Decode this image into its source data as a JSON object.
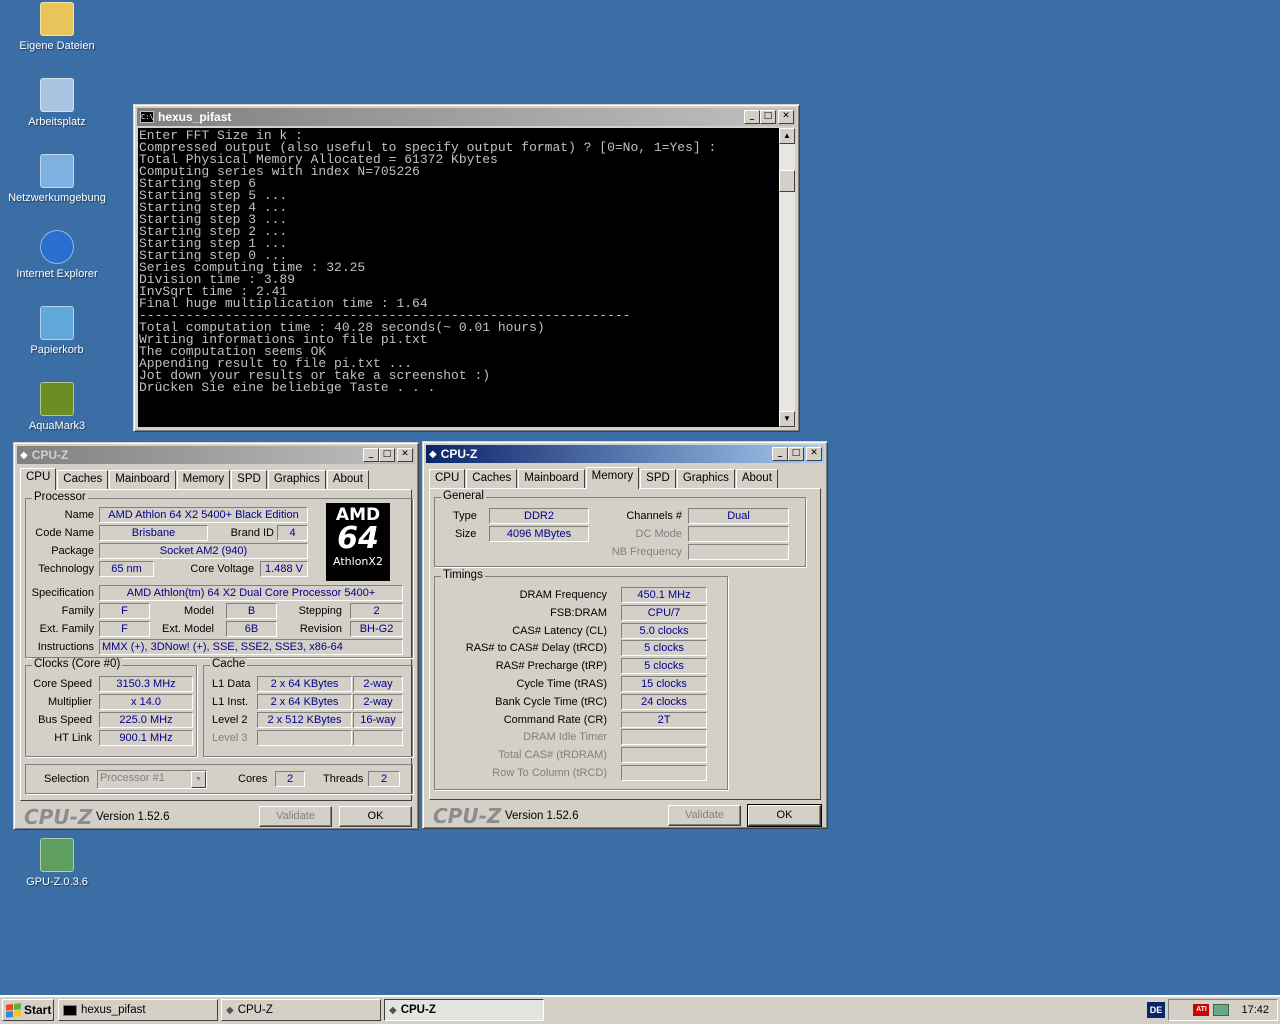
{
  "desktop": {
    "icons": [
      {
        "label": "Eigene Dateien",
        "icon": "folder-documents-icon"
      },
      {
        "label": "Arbeitsplatz",
        "icon": "my-computer-icon"
      },
      {
        "label": "Netzwerkumgebung",
        "icon": "network-icon"
      },
      {
        "label": "Internet Explorer",
        "icon": "internet-explorer-icon"
      },
      {
        "label": "Papierkorb",
        "icon": "recycle-bin-icon"
      },
      {
        "label": "AquaMark3",
        "icon": "aquamark-icon"
      },
      {
        "label": "GPU-Z.0.3.6",
        "icon": "gpu-z-icon"
      }
    ]
  },
  "console": {
    "title": "hexus_pifast",
    "lines": [
      "Enter FFT Size in k :",
      "Compressed output (also useful to specify output format) ? [0=No, 1=Yes] :",
      "Total Physical Memory Allocated = 61372 Kbytes",
      "Computing series with index N=705226",
      "Starting step 6",
      "Starting step 5 ...",
      "Starting step 4 ...",
      "Starting step 3 ...",
      "Starting step 2 ...",
      "Starting step 1 ...",
      "Starting step 0 ...",
      "Series computing time : 32.25",
      "Division time : 3.89",
      "InvSqrt time : 2.41",
      "Final huge multiplication time : 1.64",
      "---------------------------------------------------------------",
      "Total computation time : 40.28 seconds(~ 0.01 hours)",
      "Writing informations into file pi.txt",
      "",
      "The computation seems OK",
      "Appending result to file pi.txt ...",
      "",
      "Jot down your results or take a screenshot :)",
      "Drücken Sie eine beliebige Taste . . ."
    ]
  },
  "cpuz_cpu": {
    "title": "CPU-Z",
    "tabs": [
      "CPU",
      "Caches",
      "Mainboard",
      "Memory",
      "SPD",
      "Graphics",
      "About"
    ],
    "processor_group": "Processor",
    "labels": {
      "name": "Name",
      "code_name": "Code Name",
      "brand_id": "Brand ID",
      "package": "Package",
      "technology": "Technology",
      "core_voltage": "Core Voltage",
      "specification": "Specification",
      "family": "Family",
      "model": "Model",
      "stepping": "Stepping",
      "ext_family": "Ext. Family",
      "ext_model": "Ext. Model",
      "revision": "Revision",
      "instructions": "Instructions"
    },
    "values": {
      "name": "AMD Athlon 64 X2 5400+ Black Edition",
      "code_name": "Brisbane",
      "brand_id": "4",
      "package": "Socket AM2 (940)",
      "technology": "65 nm",
      "core_voltage": "1.488 V",
      "specification": "AMD Athlon(tm) 64 X2 Dual Core Processor 5400+",
      "family": "F",
      "model": "B",
      "stepping": "2",
      "ext_family": "F",
      "ext_model": "6B",
      "revision": "BH-G2",
      "instructions": "MMX (+), 3DNow! (+), SSE, SSE2, SSE3, x86-64"
    },
    "logo": {
      "brand": "AMD",
      "num": "64",
      "sub": "AthlonX2"
    },
    "clocks_group": "Clocks (Core #0)",
    "clocks": {
      "core_speed_label": "Core Speed",
      "core_speed": "3150.3 MHz",
      "multiplier_label": "Multiplier",
      "multiplier": "x 14.0",
      "bus_speed_label": "Bus Speed",
      "bus_speed": "225.0 MHz",
      "ht_link_label": "HT Link",
      "ht_link": "900.1 MHz"
    },
    "cache_group": "Cache",
    "cache": {
      "l1d_label": "L1 Data",
      "l1d": "2 x 64 KBytes",
      "l1d_way": "2-way",
      "l1i_label": "L1 Inst.",
      "l1i": "2 x 64 KBytes",
      "l1i_way": "2-way",
      "l2_label": "Level 2",
      "l2": "2 x 512 KBytes",
      "l2_way": "16-way",
      "l3_label": "Level 3"
    },
    "selection_label": "Selection",
    "selection_value": "Processor #1",
    "cores_label": "Cores",
    "cores": "2",
    "threads_label": "Threads",
    "threads": "2",
    "brand_text": "CPU-Z",
    "version": "Version 1.52.6",
    "validate": "Validate",
    "ok": "OK"
  },
  "cpuz_mem": {
    "title": "CPU-Z",
    "tabs": [
      "CPU",
      "Caches",
      "Mainboard",
      "Memory",
      "SPD",
      "Graphics",
      "About"
    ],
    "general_group": "General",
    "type_label": "Type",
    "type": "DDR2",
    "size_label": "Size",
    "size": "4096 MBytes",
    "channels_label": "Channels #",
    "channels": "Dual",
    "dc_mode_label": "DC Mode",
    "nb_freq_label": "NB Frequency",
    "timings_group": "Timings",
    "timings": [
      {
        "label": "DRAM Frequency",
        "value": "450.1 MHz",
        "dim": false
      },
      {
        "label": "FSB:DRAM",
        "value": "CPU/7",
        "dim": false
      },
      {
        "label": "CAS# Latency (CL)",
        "value": "5.0 clocks",
        "dim": false
      },
      {
        "label": "RAS# to CAS# Delay (tRCD)",
        "value": "5 clocks",
        "dim": false
      },
      {
        "label": "RAS# Precharge (tRP)",
        "value": "5 clocks",
        "dim": false
      },
      {
        "label": "Cycle Time (tRAS)",
        "value": "15 clocks",
        "dim": false
      },
      {
        "label": "Bank Cycle Time (tRC)",
        "value": "24 clocks",
        "dim": false
      },
      {
        "label": "Command Rate (CR)",
        "value": "2T",
        "dim": false
      },
      {
        "label": "DRAM Idle Timer",
        "value": "",
        "dim": true
      },
      {
        "label": "Total CAS# (tRDRAM)",
        "value": "",
        "dim": true
      },
      {
        "label": "Row To Column (tRCD)",
        "value": "",
        "dim": true
      }
    ],
    "brand_text": "CPU-Z",
    "version": "Version 1.52.6",
    "validate": "Validate",
    "ok": "OK"
  },
  "taskbar": {
    "start": "Start",
    "buttons": [
      "hexus_pifast",
      "CPU-Z",
      "CPU-Z"
    ],
    "lang": "DE",
    "clock": "17:42"
  }
}
